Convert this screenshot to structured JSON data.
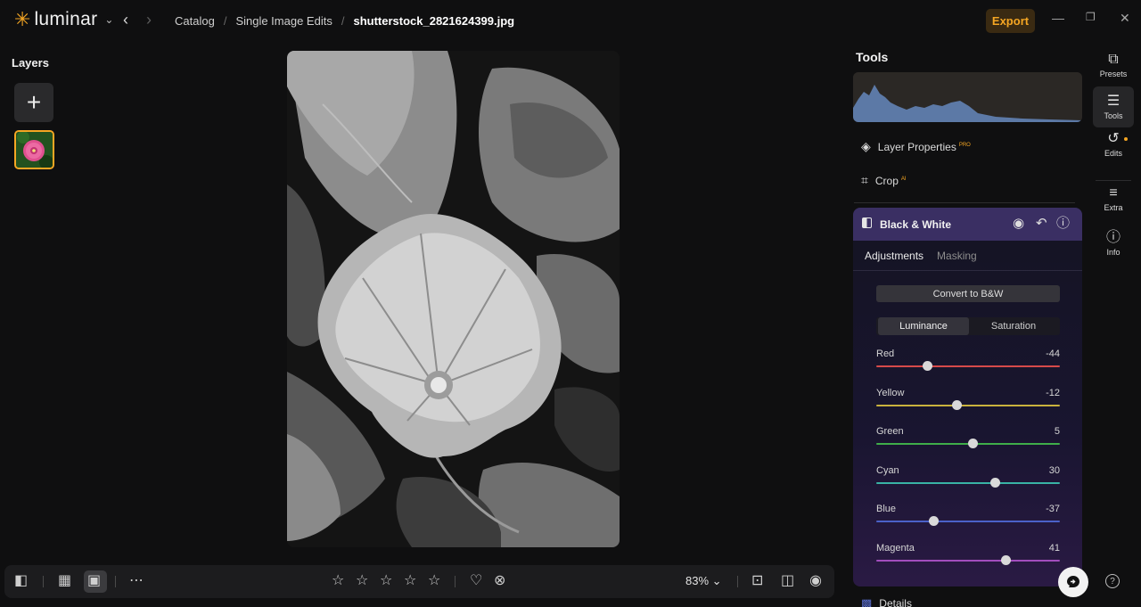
{
  "app": {
    "logo_text": "luminar",
    "accent": "#f5a623"
  },
  "breadcrumbs": [
    "Catalog",
    "Single Image Edits",
    "shutterstock_2821624399.jpg"
  ],
  "header": {
    "export_label": "Export"
  },
  "layers": {
    "title": "Layers"
  },
  "tools": {
    "title": "Tools",
    "layer_properties": "Layer Properties",
    "layer_properties_badge": "PRO",
    "crop": "Crop",
    "crop_badge": "AI",
    "details": "Details"
  },
  "bw": {
    "title": "Black & White",
    "tabs": [
      "Adjustments",
      "Masking"
    ],
    "convert_label": "Convert to B&W",
    "segments": [
      "Luminance",
      "Saturation"
    ],
    "sliders": [
      {
        "label": "Red",
        "value": "-44",
        "level": -44,
        "color": "#d64a4a"
      },
      {
        "label": "Yellow",
        "value": "-12",
        "level": -12,
        "color": "#c9b23d"
      },
      {
        "label": "Green",
        "value": "5",
        "level": 5,
        "color": "#3fae4a"
      },
      {
        "label": "Cyan",
        "value": "30",
        "level": 30,
        "color": "#39b3a5"
      },
      {
        "label": "Blue",
        "value": "-37",
        "level": -37,
        "color": "#4b62c8"
      },
      {
        "label": "Magenta",
        "value": "41",
        "level": 41,
        "color": "#a24dbd"
      }
    ]
  },
  "rail": [
    {
      "label": "Presets",
      "icon": "presets-icon"
    },
    {
      "label": "Tools",
      "icon": "sliders-icon"
    },
    {
      "label": "Edits",
      "icon": "history-icon"
    },
    {
      "label": "Extra",
      "icon": "list-icon"
    },
    {
      "label": "Info",
      "icon": "info-icon"
    }
  ],
  "bottom": {
    "zoom": "83%",
    "rating_stars": 5
  }
}
